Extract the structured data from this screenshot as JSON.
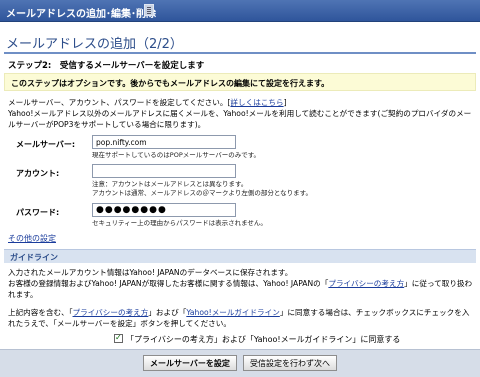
{
  "header": {
    "title": "メールアドレスの追加･編集･削除"
  },
  "page": {
    "title": "メールアドレスの追加（2/2）",
    "step": "ステップ2:　受信するメールサーバーを設定します",
    "note": "このステップはオプションです。後からでもメールアドレスの編集にて設定を行えます。"
  },
  "intro": {
    "line1": "メールサーバー、アカウント、パスワードを設定してください。[",
    "details_link": "詳しくはこちら",
    "line1_end": "]",
    "line2": "Yahoo!メールアドレス以外のメールアドレスに届くメールを、Yahoo!メールを利用して読むことができます(ご契約のプロバイダのメールサーバーがPOP3をサポートしている場合に限ります)。"
  },
  "form": {
    "server_label": "メールサーバー:",
    "server_value": "pop.nifty.com",
    "server_hint": "現在サポートしているのはPOPメールサーバーのみです。",
    "account_label": "アカウント:",
    "account_value": "",
    "account_hint1": "注意：アカウントはメールアドレスとは異なります。",
    "account_hint2": "アカウントは通常、メールアドレスの＠マークより左側の部分となります。",
    "password_label": "パスワード:",
    "password_value": "●●●●●●●●",
    "password_hint": "セキュリティー上の理由からパスワードは表示されません。"
  },
  "other_settings": "その他の設定",
  "guideline": {
    "heading": "ガイドライン",
    "p1": "入力されたメールアカウント情報はYahoo! JAPANのデータベースに保存されます。",
    "p2a": "お客様の登録情報およびYahoo! JAPANが取得したお客様に関する情報は、Yahoo! JAPANの「",
    "privacy_link": "プライバシーの考え方",
    "p2b": "」に従って取り扱われます。",
    "p3a": "上記内容を含む、「",
    "p3b": "」および「",
    "guideline_link": "Yahoo!メールガイドライン",
    "p3c": "」に同意する場合は、チェックボックスにチェックを入れたうえで、「メールサーバーを設定」ボタンを押してください。"
  },
  "agree": {
    "label": "「プライバシーの考え方」および「Yahoo!メールガイドライン」に同意する",
    "checked": true
  },
  "buttons": {
    "set_server": "メールサーバーを設定",
    "skip": "受信設定を行わず次へ"
  }
}
